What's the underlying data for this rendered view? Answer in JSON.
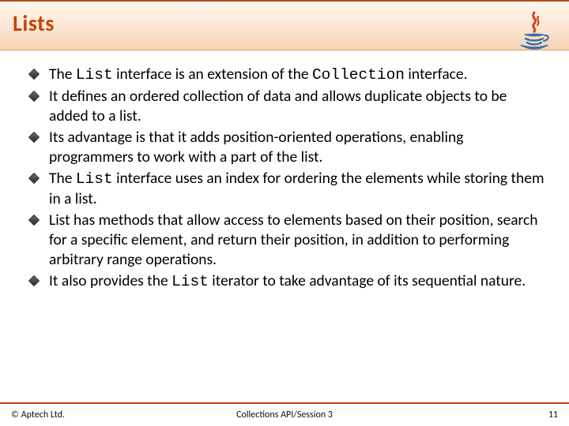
{
  "header": {
    "title": "Lists"
  },
  "bullets": [
    {
      "parts": [
        {
          "t": "The "
        },
        {
          "t": "List",
          "mono": true
        },
        {
          "t": " interface is an extension of the "
        },
        {
          "t": "Collection",
          "mono": true
        },
        {
          "t": " interface."
        }
      ]
    },
    {
      "parts": [
        {
          "t": "It defines an ordered collection of data and allows duplicate objects to be added to a list."
        }
      ]
    },
    {
      "parts": [
        {
          "t": "Its advantage is that it adds position-oriented operations, enabling programmers to work with a part of the list."
        }
      ]
    },
    {
      "parts": [
        {
          "t": "The "
        },
        {
          "t": "List",
          "mono": true
        },
        {
          "t": " interface uses an index for ordering the elements while storing them in a list."
        }
      ]
    },
    {
      "parts": [
        {
          "t": "List has methods that allow access to elements based on their position, search for a specific element, and return their position, in addition to performing arbitrary range operations."
        }
      ]
    },
    {
      "parts": [
        {
          "t": "It also provides the "
        },
        {
          "t": "List",
          "mono": true
        },
        {
          "t": " iterator to take advantage of its sequential nature."
        }
      ]
    }
  ],
  "footer": {
    "left": "© Aptech Ltd.",
    "center": "Collections API/Session 3",
    "page": "11"
  }
}
